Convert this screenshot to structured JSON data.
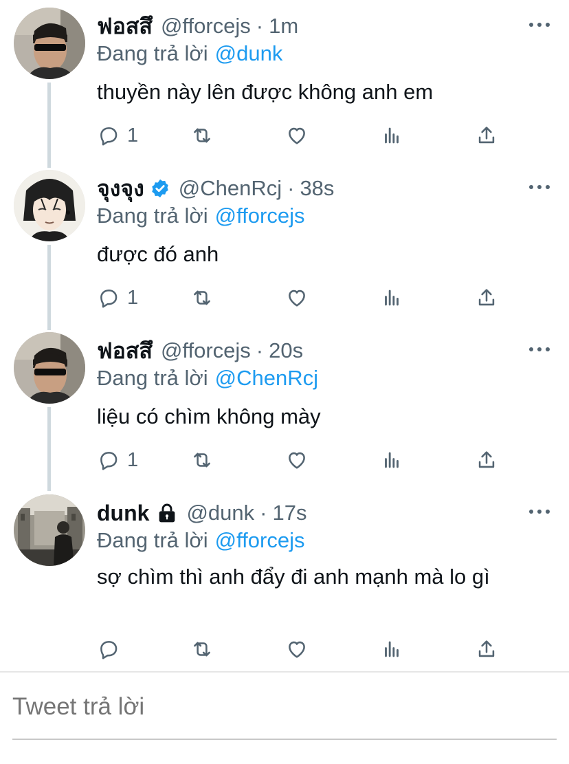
{
  "tweets": [
    {
      "name": "ฟอสสึ",
      "handle": "@fforcejs",
      "dot": "·",
      "time": "1m",
      "replying_label": "Đang trả lời",
      "replying_to": "@dunk",
      "text": "thuyền này lên được không anh em",
      "reply_count": "1",
      "badge": "none"
    },
    {
      "name": "จุงจุง",
      "handle": "@ChenRcj",
      "dot": "·",
      "time": "38s",
      "replying_label": "Đang trả lời",
      "replying_to": "@fforcejs",
      "text": "được đó anh",
      "reply_count": "1",
      "badge": "verified"
    },
    {
      "name": "ฟอสสึ",
      "handle": "@fforcejs",
      "dot": "·",
      "time": "20s",
      "replying_label": "Đang trả lời",
      "replying_to": "@ChenRcj",
      "text": "liệu có chìm không mày",
      "reply_count": "1",
      "badge": "none"
    },
    {
      "name": "dunk",
      "handle": "@dunk",
      "dot": "·",
      "time": "17s",
      "replying_label": "Đang trả lời",
      "replying_to": "@fforcejs",
      "text": "sợ chìm thì anh đẩy đi anh mạnh mà lo gì",
      "reply_count": "",
      "badge": "lock"
    }
  ],
  "composer": {
    "placeholder": "Tweet trả lời"
  },
  "colors": {
    "link": "#1d9bf0",
    "secondary_text": "#536471",
    "thread_line": "#cfd9de",
    "verified": "#1d9bf0"
  },
  "icons": {
    "reply": "reply-icon",
    "retweet": "retweet-icon",
    "like": "heart-icon",
    "views": "views-icon",
    "share": "share-icon",
    "more": "more-icon",
    "verified": "verified-badge-icon",
    "lock": "lock-icon"
  }
}
